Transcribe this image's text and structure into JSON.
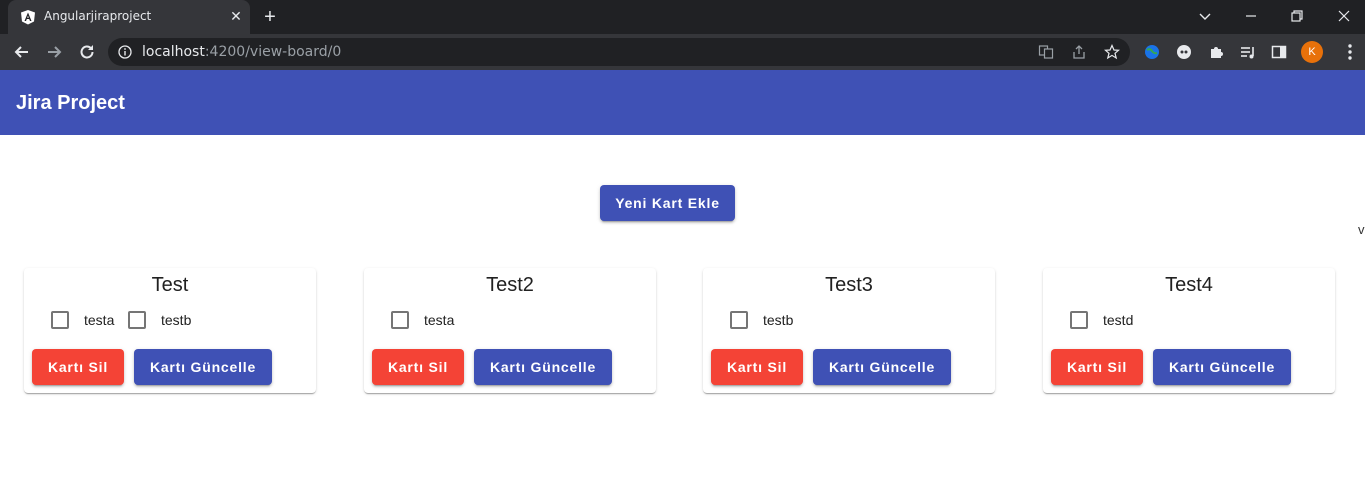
{
  "browser": {
    "tab_title": "Angularjiraproject",
    "url_host": "localhost",
    "url_path": ":4200/view-board/0",
    "profile_initial": "K"
  },
  "app": {
    "title": "Jira Project",
    "add_card_label": "Yeni Kart Ekle",
    "edge_text": "v",
    "primary_color": "#3f51b5",
    "warn_color": "#f44336"
  },
  "cards": [
    {
      "title": "Test",
      "items": [
        "testa",
        "testb"
      ],
      "delete_label": "Kartı Sil",
      "update_label": "Kartı Güncelle"
    },
    {
      "title": "Test2",
      "items": [
        "testa"
      ],
      "delete_label": "Kartı Sil",
      "update_label": "Kartı Güncelle"
    },
    {
      "title": "Test3",
      "items": [
        "testb"
      ],
      "delete_label": "Kartı Sil",
      "update_label": "Kartı Güncelle"
    },
    {
      "title": "Test4",
      "items": [
        "testd"
      ],
      "delete_label": "Kartı Sil",
      "update_label": "Kartı Güncelle"
    }
  ]
}
